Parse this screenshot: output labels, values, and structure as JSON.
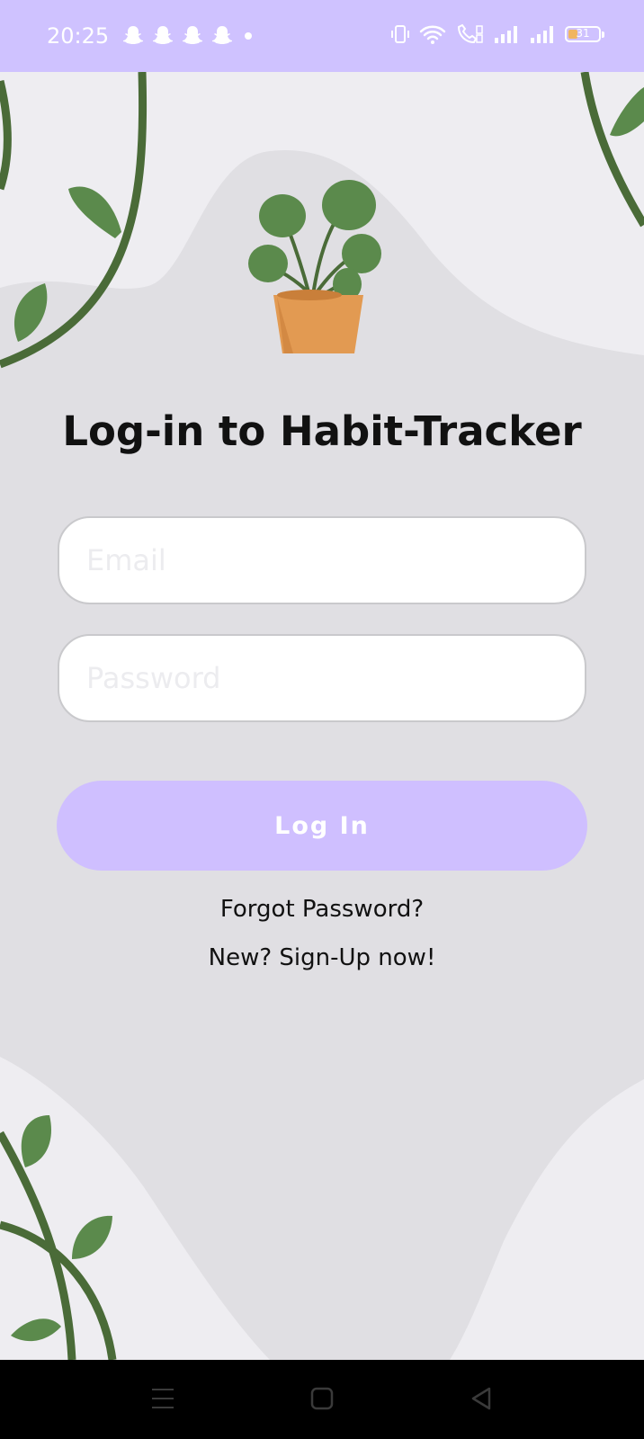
{
  "status_bar": {
    "time": "20:25",
    "notification_icons": [
      "snapchat-icon",
      "snapchat-icon",
      "snapchat-icon",
      "snapchat-icon",
      "dot-icon"
    ],
    "system_icons": [
      "vibrate-icon",
      "wifi-icon",
      "volte-call-icon",
      "signal-icon",
      "signal-icon"
    ],
    "battery_level": "31",
    "background_color": "#cfc2ff",
    "battery_color": "#f1b561"
  },
  "login": {
    "title": "Log-in to Habit-Tracker",
    "email_placeholder": "Email",
    "password_placeholder": "Password",
    "login_label": "Log In",
    "forgot_password": "Forgot Password?",
    "signup": "New? Sign-Up now!"
  },
  "theme": {
    "accent": "#cfbfff",
    "leaf_green": "#5b8a4c",
    "vine_green": "#4a6b38",
    "pot_orange": "#e29a52",
    "blob_gray": "#e0dfe3",
    "background": "#eeedf1"
  },
  "nav_bar": {
    "buttons": [
      "menu-icon",
      "home-icon",
      "back-icon"
    ]
  }
}
